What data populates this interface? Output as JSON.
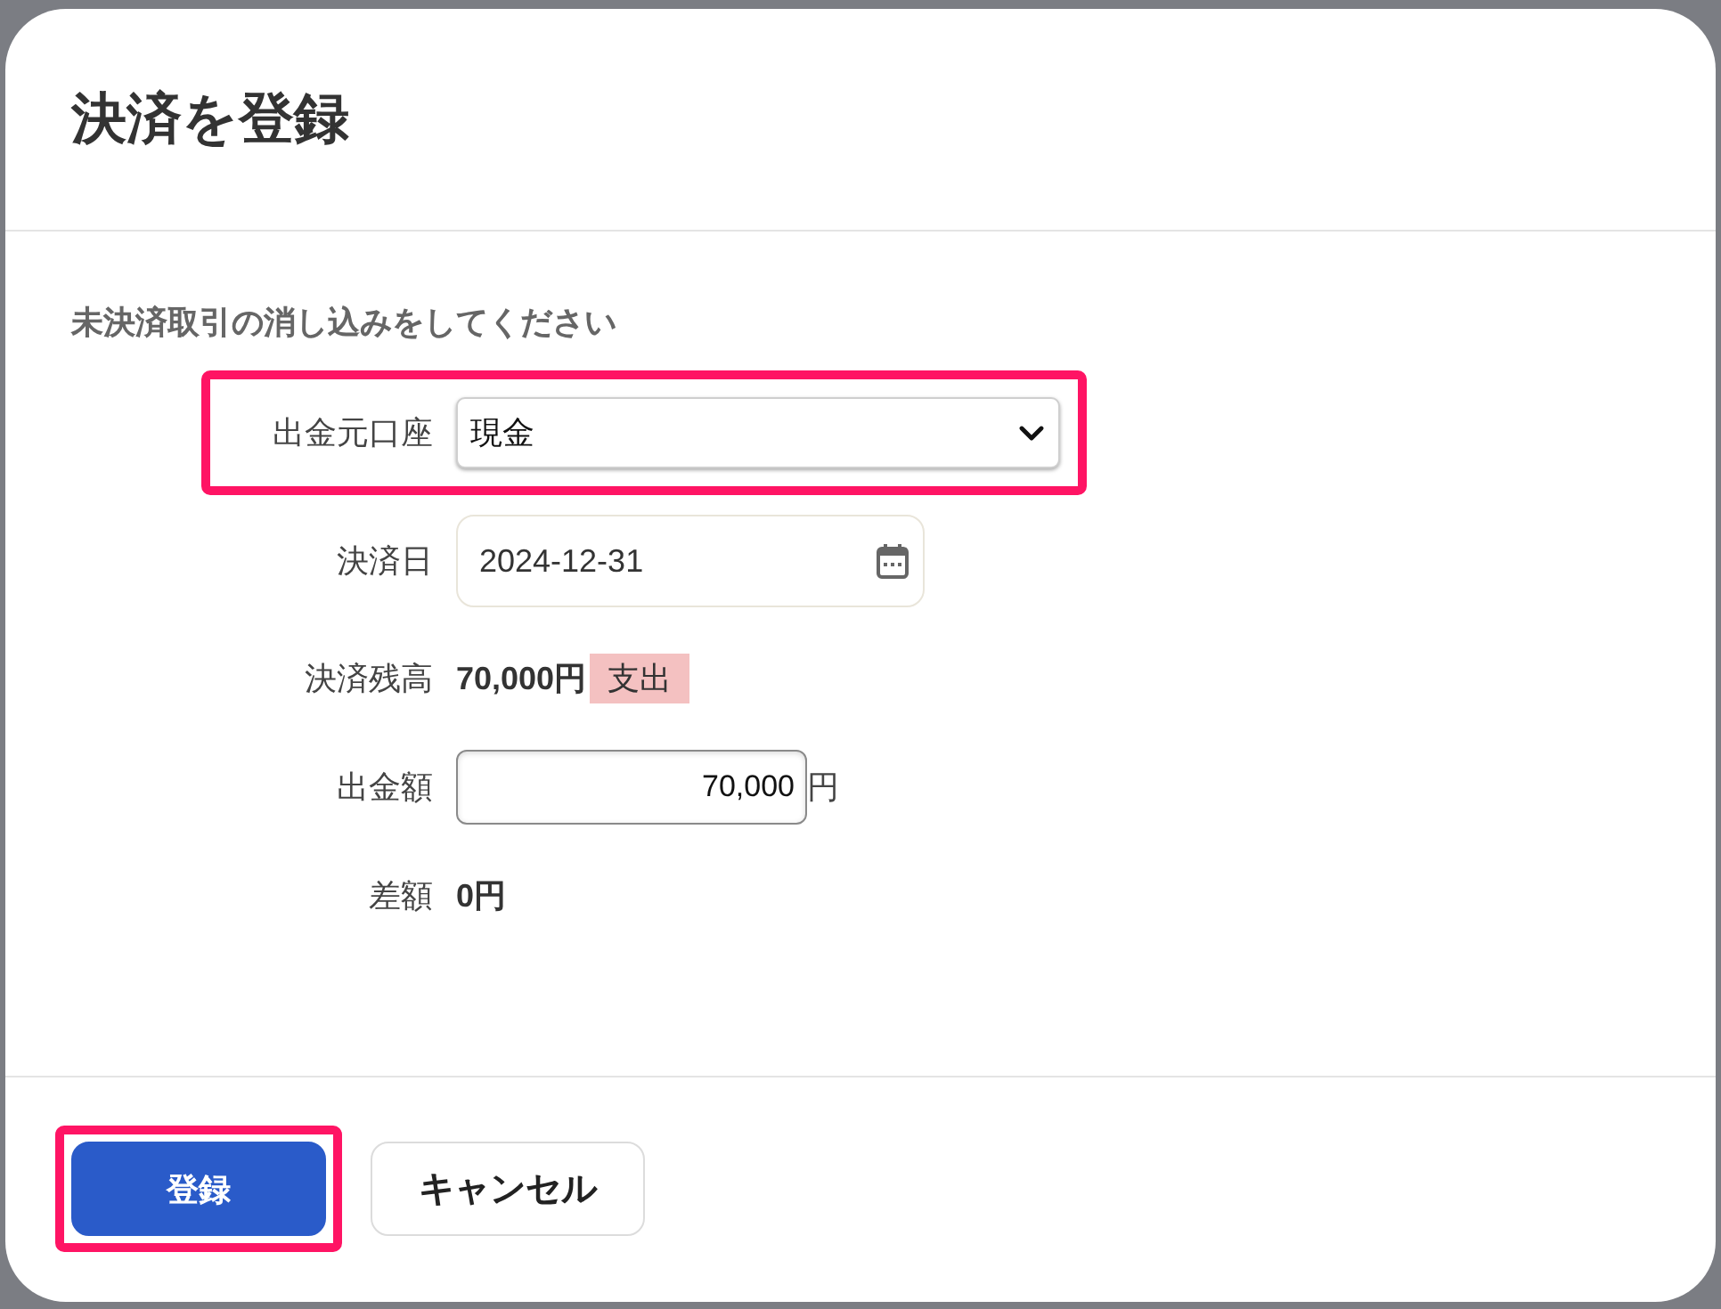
{
  "dialog": {
    "title": "決済を登録",
    "instruction": "未決済取引の消し込みをしてください",
    "fields": [
      {
        "kind": "select",
        "label": "出金元口座",
        "value": "現金",
        "highlighted": true
      },
      {
        "kind": "date",
        "label": "決済日",
        "value": "2024-12-31",
        "highlighted": false
      },
      {
        "kind": "amount",
        "label": "決済残高",
        "value": "70,000円",
        "tag": "支出",
        "highlighted": false
      },
      {
        "kind": "number",
        "label": "出金額",
        "value": "70,000",
        "unit": "円",
        "highlighted": false
      },
      {
        "kind": "amount",
        "label": "差額",
        "value": "0円",
        "highlighted": false
      }
    ],
    "buttons": [
      {
        "kind": "primary",
        "label": "登録",
        "highlighted": true
      },
      {
        "kind": "secondary",
        "label": "キャンセル",
        "highlighted": false
      }
    ]
  }
}
